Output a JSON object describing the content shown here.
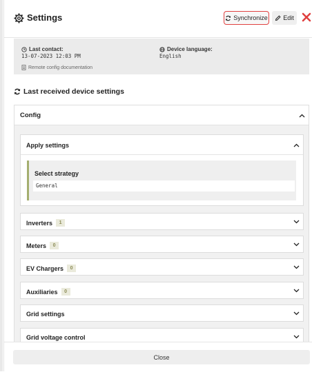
{
  "header": {
    "title": "Settings",
    "synchronize_label": "Synchronize",
    "edit_label": "Edit"
  },
  "info": {
    "last_contact_label": "Last contact:",
    "last_contact_value": "13-07-2023 12:03 PM",
    "device_language_label": "Device language:",
    "device_language_value": "English",
    "doc_link": "Remote config documentation"
  },
  "section": {
    "title": "Last received device settings"
  },
  "config": {
    "title": "Config",
    "apply": {
      "title": "Apply settings",
      "strategy_label": "Select strategy",
      "strategy_value": "General"
    },
    "items": [
      {
        "label": "Inverters",
        "badge": "1"
      },
      {
        "label": "Meters",
        "badge": "0"
      },
      {
        "label": "EV Chargers",
        "badge": "0"
      },
      {
        "label": "Auxiliaries",
        "badge": "0"
      },
      {
        "label": "Grid settings"
      },
      {
        "label": "Grid voltage control"
      }
    ]
  },
  "footer": {
    "close_label": "Close"
  },
  "colors": {
    "accent_red": "#e0403f",
    "strategy_bar": "#a4ae6f",
    "badge_bg": "#eaeadb"
  },
  "icons": [
    "gear-icon",
    "sync-icon",
    "pencil-icon",
    "close-icon",
    "clock-icon",
    "globe-icon",
    "document-icon",
    "refresh-icon",
    "chevron-up-icon",
    "chevron-down-icon"
  ]
}
